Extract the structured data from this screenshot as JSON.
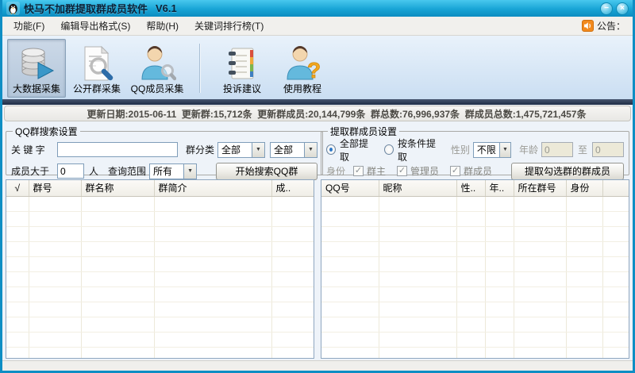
{
  "window": {
    "title": "快马不加群提取群成员软件",
    "version": "V6.1"
  },
  "icons": {
    "minimize": "−",
    "close": "×",
    "dropdown_arrow": "▼",
    "check": "✓"
  },
  "menubar": {
    "items": [
      {
        "label": "功能(F)"
      },
      {
        "label": "编辑导出格式(S)"
      },
      {
        "label": "帮助(H)"
      },
      {
        "label": "关键词排行榜(T)"
      }
    ],
    "announcement_label": "公告："
  },
  "toolbar": {
    "buttons": [
      {
        "label": "大数据采集",
        "icon": "database-collect-icon",
        "selected": true
      },
      {
        "label": "公开群采集",
        "icon": "doc-search-icon",
        "selected": false
      },
      {
        "label": "QQ成员采集",
        "icon": "member-search-icon",
        "selected": false
      },
      {
        "label": "投诉建议",
        "icon": "feedback-notebook-icon",
        "selected": false
      },
      {
        "label": "使用教程",
        "icon": "tutorial-question-icon",
        "selected": false
      }
    ]
  },
  "update_band": {
    "text": "更新日期:2015-06-11  更新群:15,712条  更新群成员:20,144,799条  群总数:76,996,937条  群成员总数:1,475,721,457条"
  },
  "search_panel": {
    "title": "QQ群搜索设置",
    "keyword_label": "关 键 字",
    "keyword_value": "",
    "category_label": "群分类",
    "category1_value": "全部",
    "category2_value": "全部",
    "members_gt_label": "成员大于",
    "members_gt_value": "0",
    "members_unit": "人",
    "range_label": "查询范围",
    "range_value": "所有",
    "search_button": "开始搜索QQ群"
  },
  "extract_panel": {
    "title": "提取群成员设置",
    "radio_all": {
      "label": "全部提取",
      "checked": true
    },
    "radio_cond": {
      "label": "按条件提取",
      "checked": false
    },
    "gender_label": "性别",
    "gender_value": "不限",
    "age_label": "年龄",
    "age_from": "0",
    "age_to_label": "至",
    "age_to": "0",
    "identity_label": "身份",
    "identity_options": [
      {
        "label": "群主",
        "checked": true
      },
      {
        "label": "管理员",
        "checked": true
      },
      {
        "label": "群成员",
        "checked": true
      }
    ],
    "extract_button": "提取勾选群的群成员"
  },
  "group_table": {
    "columns": [
      "√",
      "群号",
      "群名称",
      "群简介",
      "成.."
    ],
    "rows": []
  },
  "member_table": {
    "columns": [
      "QQ号",
      "昵称",
      "性..",
      "年..",
      "所在群号",
      "身份",
      ""
    ],
    "rows": []
  },
  "colors": {
    "titlebar_teal": "#18a4d5",
    "window_border": "#0e8ec4",
    "toolbar_blue": "#cadef2",
    "dark_stripe": "#1f2d46",
    "announce_orange": "#f28a1e",
    "disabled_field": "#ece9d8",
    "table_border": "#8fa7c0"
  }
}
